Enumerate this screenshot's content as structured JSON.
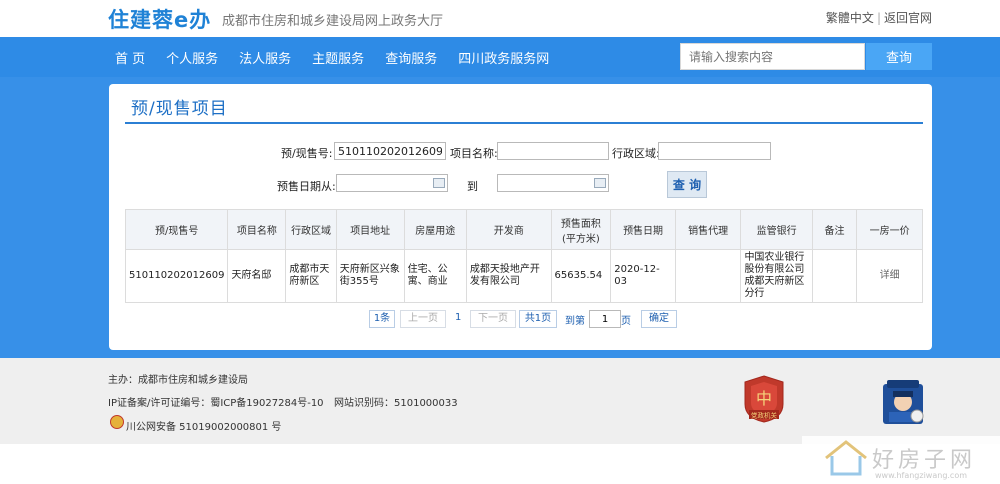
{
  "header": {
    "logo": "住建蓉e办",
    "subtitle": "成都市住房和城乡建设局网上政务大厅",
    "lang_link": "繁體中文",
    "home_link": "返回官网"
  },
  "nav": {
    "items": [
      "首  页",
      "个人服务",
      "法人服务",
      "主题服务",
      "查询服务",
      "四川政务服务网"
    ],
    "search_placeholder": "请输入搜索内容",
    "search_button": "查询"
  },
  "panel": {
    "title": "预/现售项目"
  },
  "form": {
    "presale_no_label": "预/现售号:",
    "presale_no_value": "510110202012609",
    "project_name_label": "项目名称:",
    "project_name_value": "",
    "district_label": "行政区域:",
    "district_value": "",
    "date_from_label": "预售日期从:",
    "date_to_label": "到",
    "query_button": "查 询"
  },
  "table": {
    "columns": [
      "预/现售号",
      "项目名称",
      "行政区域",
      "项目地址",
      "房屋用途",
      "开发商",
      "预售面积(平方米)",
      "预售日期",
      "销售代理",
      "监管银行",
      "备注",
      "一房一价"
    ],
    "rows": [
      {
        "presale_no": "510110202012609",
        "project_name": "天府名邸",
        "district": "成都市天府新区",
        "address": "天府新区兴象街355号",
        "usage": "住宅、公寓、商业",
        "developer": "成都天投地产开发有限公司",
        "area": "65635.54",
        "date": "2020-12-03",
        "agent": "",
        "bank": "中国农业银行股份有限公司成都天府新区分行",
        "remark": "",
        "detail_link": "详细"
      }
    ]
  },
  "pagination": {
    "total": "1条",
    "prev": "上一页",
    "current": "1",
    "next": "下一页",
    "pages": "共1页",
    "goto_label": "到第",
    "goto_value": "1",
    "page_suffix": "页",
    "confirm": "确定"
  },
  "footer": {
    "sponsor": "主办：成都市住房和城乡建设局",
    "icp": "IP证备案/许可证编号：蜀ICP备19027284号-10",
    "site_id": "网站识别码：5101000033",
    "police_record": "川公网安备 51019002000801 号",
    "emblem_text": "党政机关"
  },
  "watermark": {
    "text": "好房子网",
    "url": "www.hfangziwang.com"
  },
  "colors": {
    "brand_blue": "#2e8be6",
    "title_blue": "#1d6fc5"
  }
}
